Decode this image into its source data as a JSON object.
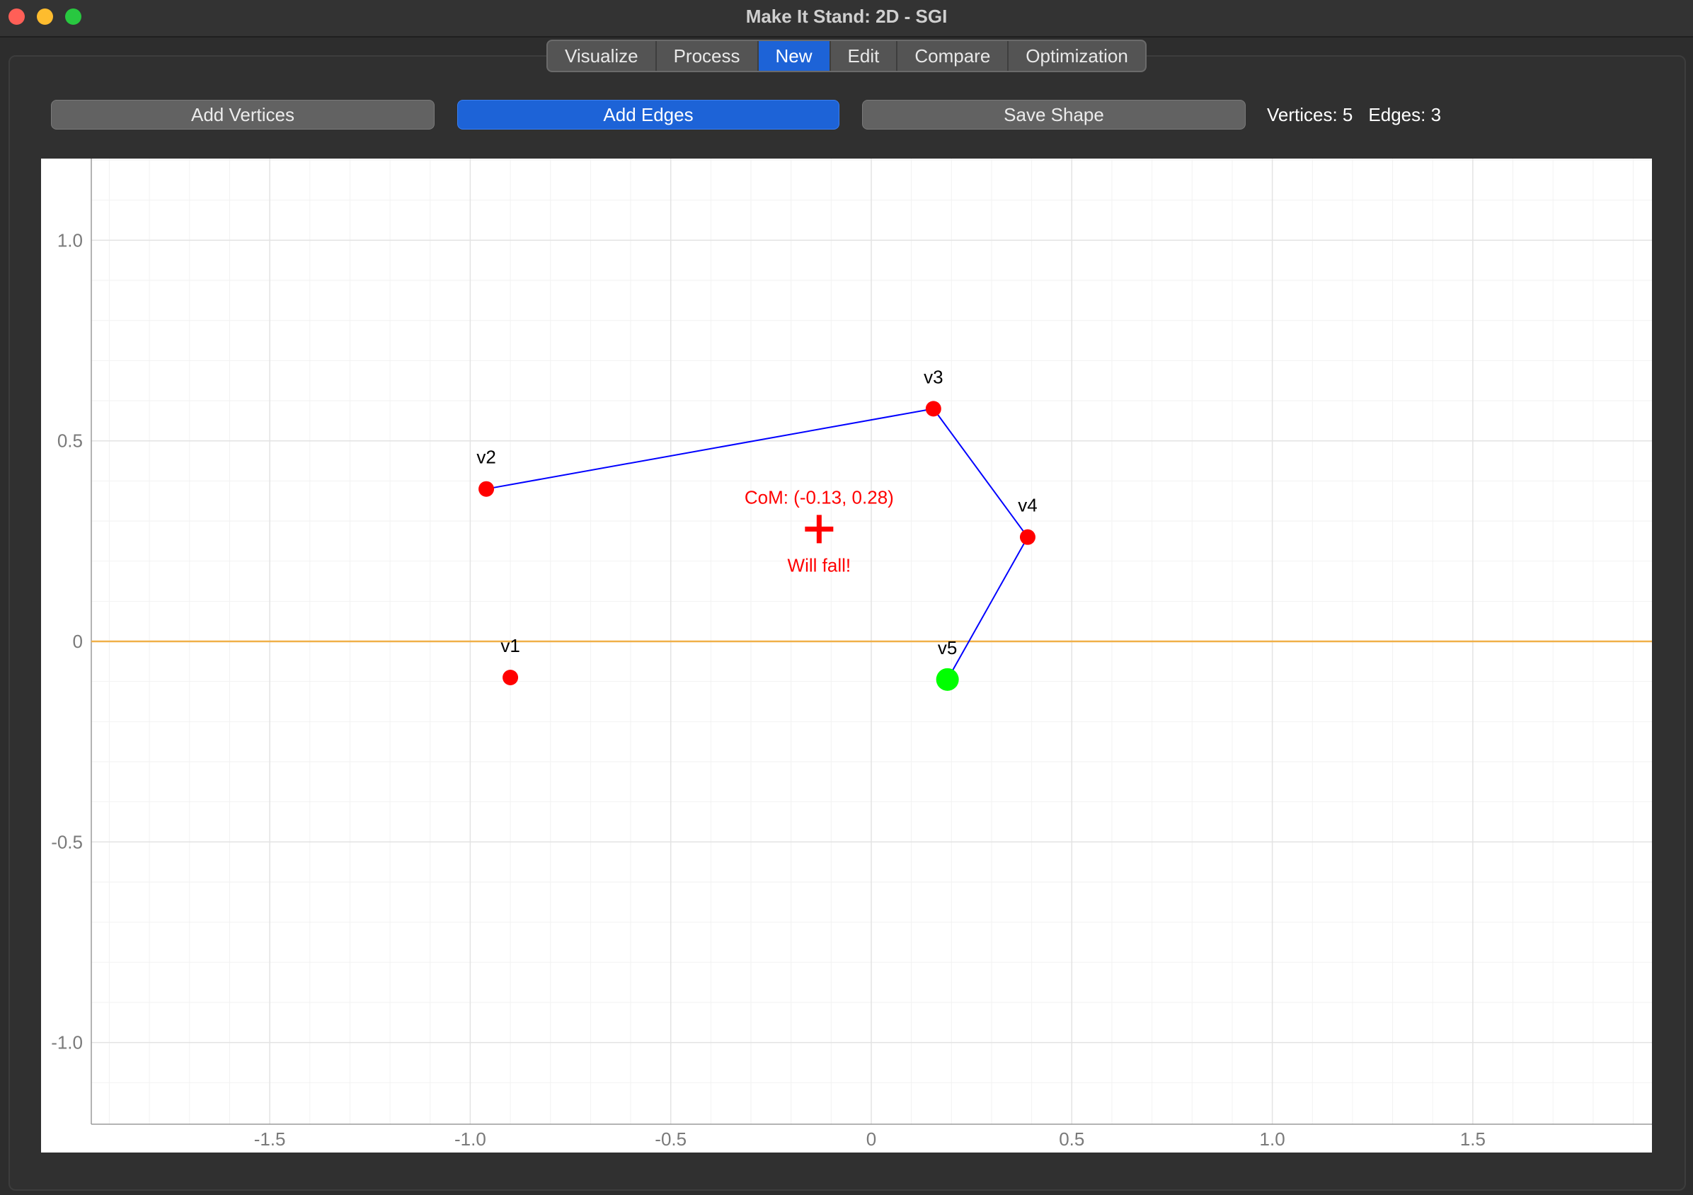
{
  "window": {
    "title": "Make It Stand: 2D - SGI"
  },
  "tabs": [
    {
      "label": "Visualize",
      "active": false
    },
    {
      "label": "Process",
      "active": false
    },
    {
      "label": "New",
      "active": true
    },
    {
      "label": "Edit",
      "active": false
    },
    {
      "label": "Compare",
      "active": false
    },
    {
      "label": "Optimization",
      "active": false
    }
  ],
  "toolbar": {
    "add_vertices_label": "Add Vertices",
    "add_edges_label": "Add Edges",
    "save_shape_label": "Save Shape",
    "add_edges_active": true
  },
  "stats": {
    "vertices_text": "Vertices: 5",
    "edges_text": "Edges: 3"
  },
  "colors": {
    "accent": "#1d63d7",
    "vertex": "#ff0000",
    "selected_vertex": "#00ff00",
    "edge": "#0000ff",
    "ground_line": "#f0b048",
    "com": "#ff0000"
  },
  "plot": {
    "x_ticks": [
      "-1.5",
      "-1.0",
      "-0.5",
      "0",
      "0.5",
      "1.0",
      "1.5"
    ],
    "x_tick_values": [
      -1.5,
      -1.0,
      -0.5,
      0,
      0.5,
      1.0,
      1.5
    ],
    "y_ticks": [
      "1.0",
      "0.5",
      "0",
      "-0.5",
      "-1.0"
    ],
    "y_tick_values": [
      1.0,
      0.5,
      0,
      -0.5,
      -1.0
    ],
    "xlim": [
      -1.95,
      1.95
    ],
    "ylim": [
      -1.2,
      1.2
    ],
    "grid": true,
    "ground_y": 0,
    "vertices": [
      {
        "label": "v1",
        "x": -0.9,
        "y": -0.09,
        "selected": false
      },
      {
        "label": "v2",
        "x": -0.96,
        "y": 0.38,
        "selected": false
      },
      {
        "label": "v3",
        "x": 0.155,
        "y": 0.58,
        "selected": false
      },
      {
        "label": "v4",
        "x": 0.39,
        "y": 0.26,
        "selected": false
      },
      {
        "label": "v5",
        "x": 0.19,
        "y": -0.095,
        "selected": true
      }
    ],
    "edges": [
      [
        "v2",
        "v3"
      ],
      [
        "v3",
        "v4"
      ],
      [
        "v4",
        "v5"
      ]
    ],
    "com": {
      "x": -0.13,
      "y": 0.28,
      "label": "CoM: (-0.13, 0.28)",
      "status": "Will fall!"
    }
  }
}
